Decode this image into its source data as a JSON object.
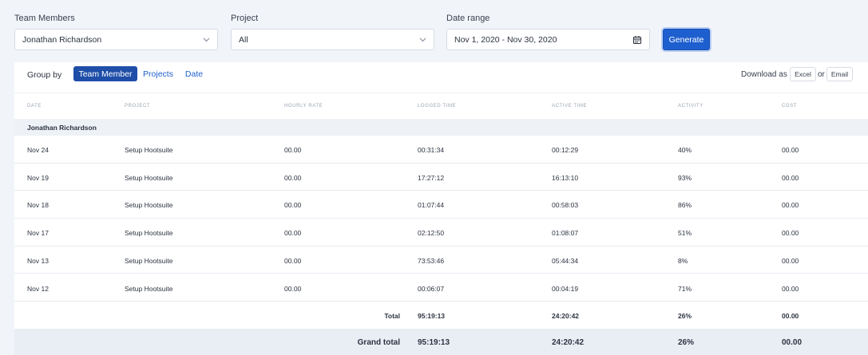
{
  "filters": {
    "team_members": {
      "label": "Team Members",
      "value": "Jonathan Richardson"
    },
    "project": {
      "label": "Project",
      "value": "All"
    },
    "date_range": {
      "label": "Date range",
      "value": "Nov 1, 2020 - Nov 30, 2020"
    },
    "generate_label": "Generate"
  },
  "toolbar": {
    "group_by_label": "Group by",
    "group_options": [
      "Team Member",
      "Projects",
      "Date"
    ],
    "active_group": "Team Member",
    "download_label": "Download as",
    "excel_label": "Excel",
    "or_label": "or",
    "email_label": "Email"
  },
  "table": {
    "columns": [
      "Date",
      "Project",
      "Hourly rate",
      "Logged time",
      "Active time",
      "Activity",
      "Cost"
    ],
    "group_name": "Jonathan Richardson",
    "rows": [
      {
        "date": "Nov 24",
        "project": "Setup Hootsuite",
        "rate": "00.00",
        "logged": "00:31:34",
        "active": "00:12:29",
        "activity": "40%",
        "cost": "00.00"
      },
      {
        "date": "Nov 19",
        "project": "Setup Hootsuite",
        "rate": "00.00",
        "logged": "17:27:12",
        "active": "16:13:10",
        "activity": "93%",
        "cost": "00.00"
      },
      {
        "date": "Nov 18",
        "project": "Setup Hootsuite",
        "rate": "00.00",
        "logged": "01:07:44",
        "active": "00:58:03",
        "activity": "86%",
        "cost": "00.00"
      },
      {
        "date": "Nov 17",
        "project": "Setup Hootsuite",
        "rate": "00.00",
        "logged": "02:12:50",
        "active": "01:08:07",
        "activity": "51%",
        "cost": "00.00"
      },
      {
        "date": "Nov 13",
        "project": "Setup Hootsuite",
        "rate": "00.00",
        "logged": "73:53:46",
        "active": "05:44:34",
        "activity": "8%",
        "cost": "00.00"
      },
      {
        "date": "Nov 12",
        "project": "Setup Hootsuite",
        "rate": "00.00",
        "logged": "00:06:07",
        "active": "00:04:19",
        "activity": "71%",
        "cost": "00.00"
      }
    ],
    "total": {
      "label": "Total",
      "logged": "95:19:13",
      "active": "24:20:42",
      "activity": "26%",
      "cost": "00.00"
    },
    "grand_total": {
      "label": "Grand total",
      "logged": "95:19:13",
      "active": "24:20:42",
      "activity": "26%",
      "cost": "00.00"
    }
  },
  "colors": {
    "accent": "#1e5fcf",
    "active_tab": "#1e4ea8"
  },
  "icons": {
    "dropdown": "chevron-down-icon",
    "date": "calendar-icon"
  }
}
